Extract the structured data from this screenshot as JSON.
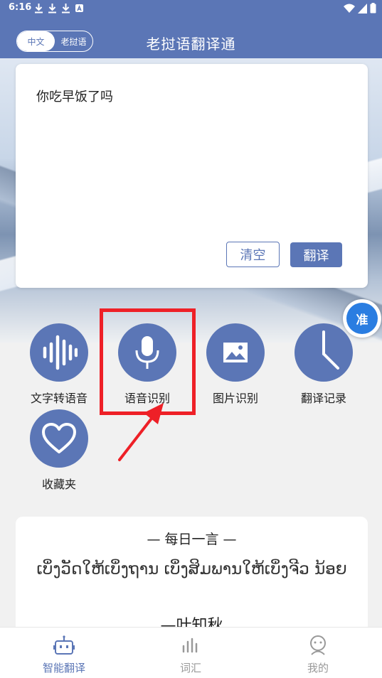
{
  "status_bar": {
    "time": "6:16"
  },
  "header": {
    "title": "老挝语翻译通",
    "lang_toggle": {
      "active": "中文",
      "inactive": "老挝语"
    }
  },
  "input": {
    "text": "你吃早饭了吗",
    "clear_label": "清空",
    "translate_label": "翻译"
  },
  "float_badge": {
    "label": "准"
  },
  "features": [
    {
      "label": "文字转语音",
      "icon": "sound-wave-icon"
    },
    {
      "label": "语音识别",
      "icon": "microphone-icon"
    },
    {
      "label": "图片识别",
      "icon": "image-icon"
    },
    {
      "label": "翻译记录",
      "icon": "clock-icon"
    },
    {
      "label": "收藏夹",
      "icon": "heart-icon"
    }
  ],
  "daily_quote": {
    "title": "—  每日一言  —",
    "text": "ເບິ່ງວັດໃຫ້ເບິ່ງຖານ ເບິ່ງສິມພານໃຫ້ເບິ່ງຈີວ ນ້ອຍ",
    "author": "—叶知秋"
  },
  "tabs": [
    {
      "label": "智能翻译",
      "icon": "robot-icon",
      "active": true
    },
    {
      "label": "词汇",
      "icon": "bars-icon",
      "active": false
    },
    {
      "label": "我的",
      "icon": "user-icon",
      "active": false
    }
  ],
  "colors": {
    "primary": "#5b76b6",
    "highlight": "#ee2027",
    "badge": "#2a7de1"
  }
}
